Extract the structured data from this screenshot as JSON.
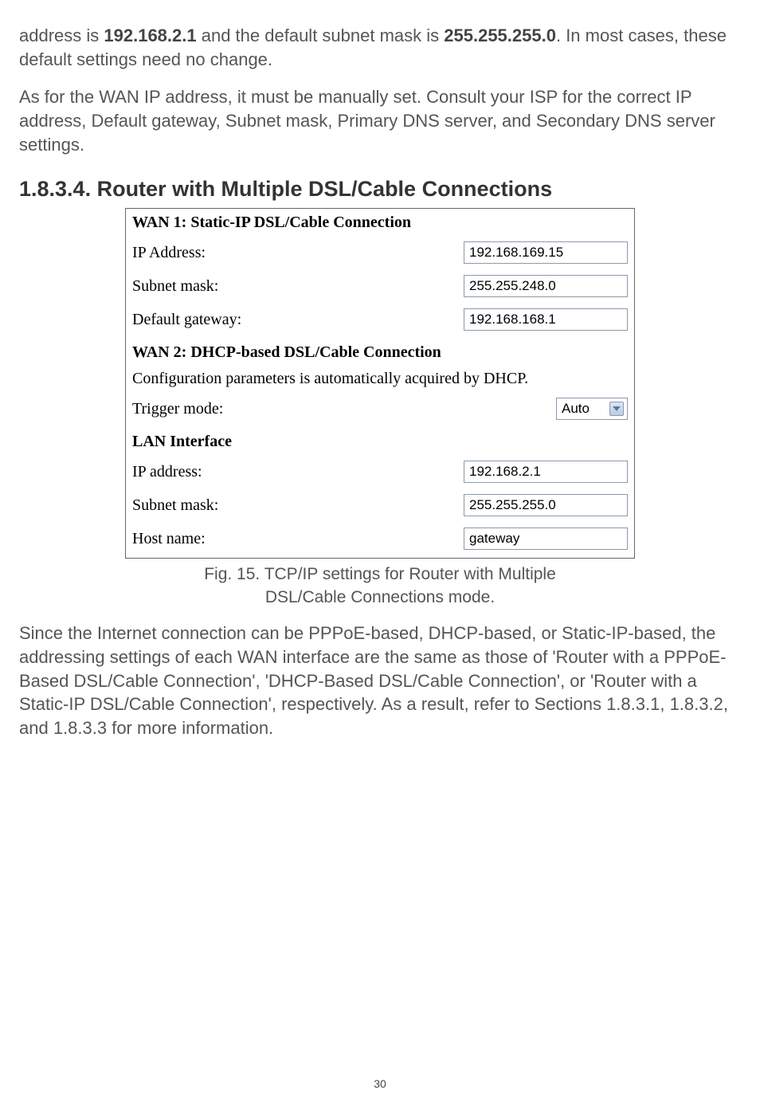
{
  "paragraphs": {
    "p1_pre": "address is ",
    "p1_ip": "192.168.2.1",
    "p1_mid": " and the default subnet mask is ",
    "p1_mask": "255.255.255.0",
    "p1_post": ". In most cases, these default settings need no change.",
    "p2": "As for the WAN IP address, it must be manually set. Consult your ISP for the correct IP address, Default gateway, Subnet mask, Primary DNS server, and Secondary DNS server settings.",
    "p3": "Since the Internet connection can be PPPoE-based, DHCP-based, or Static-IP-based, the addressing settings of each WAN interface are the same as those of 'Router with a PPPoE-Based DSL/Cable Connection', 'DHCP-Based DSL/Cable Connection', or 'Router with a Static-IP DSL/Cable Connection', respectively. As a result, refer to Sections 1.8.3.1, 1.8.3.2, and 1.8.3.3 for more information."
  },
  "heading": "1.8.3.4. Router with Multiple DSL/Cable Connections",
  "caption_line1": "Fig. 15. TCP/IP settings for Router with Multiple",
  "caption_line2": "DSL/Cable Connections mode.",
  "table": {
    "wan1_header": "WAN 1: Static-IP DSL/Cable Connection",
    "wan1": {
      "ip_label": "IP Address:",
      "ip_value": "192.168.169.15",
      "subnet_label": "Subnet mask:",
      "subnet_value": "255.255.248.0",
      "gateway_label": "Default gateway:",
      "gateway_value": "192.168.168.1"
    },
    "wan2_header": "WAN 2: DHCP-based DSL/Cable Connection",
    "wan2": {
      "note": "Configuration parameters is automatically acquired by DHCP.",
      "trigger_label": "Trigger mode:",
      "trigger_value": "Auto"
    },
    "lan_header": "LAN Interface",
    "lan": {
      "ip_label": "IP address:",
      "ip_value": "192.168.2.1",
      "subnet_label": "Subnet mask:",
      "subnet_value": "255.255.255.0",
      "host_label": "Host name:",
      "host_value": "gateway"
    }
  },
  "page_number": "30"
}
